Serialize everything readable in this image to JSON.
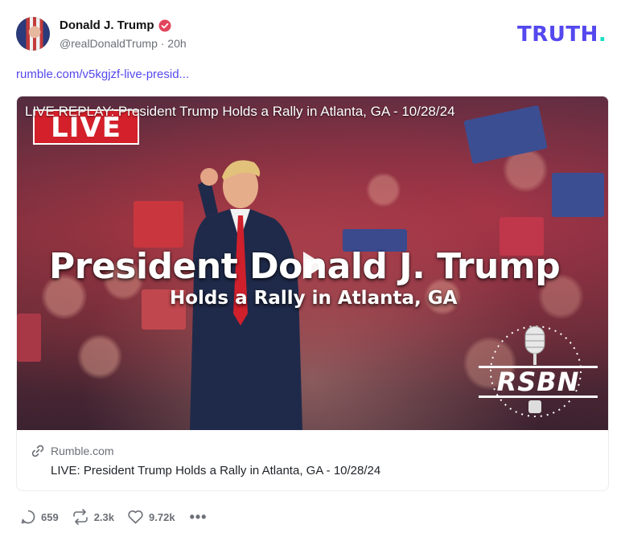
{
  "post": {
    "author_name": "Donald J. Trump",
    "handle_time": "@realDonaldTrump · 20h",
    "link_text": "rumble.com/v5kgjzf-live-presid..."
  },
  "brand": {
    "logo_main": "TRUTH",
    "logo_dot": "."
  },
  "video": {
    "title": "LIVE REPLAY: President Trump Holds a Rally in Atlanta, GA - 10/28/24",
    "live_badge": "LIVE",
    "headline": "President Donald J. Trump",
    "subhead": "Holds a Rally in Atlanta, GA",
    "network": "RSBN"
  },
  "card": {
    "source": "Rumble.com",
    "title": "LIVE: President Trump Holds a Rally in Atlanta, GA - 10/28/24"
  },
  "actions": {
    "replies": "659",
    "retruths": "2.3k",
    "likes": "9.72k",
    "more": "•••"
  },
  "colors": {
    "accent": "#5448ee",
    "verified": "#e2445c",
    "live_red": "#d3202a"
  }
}
